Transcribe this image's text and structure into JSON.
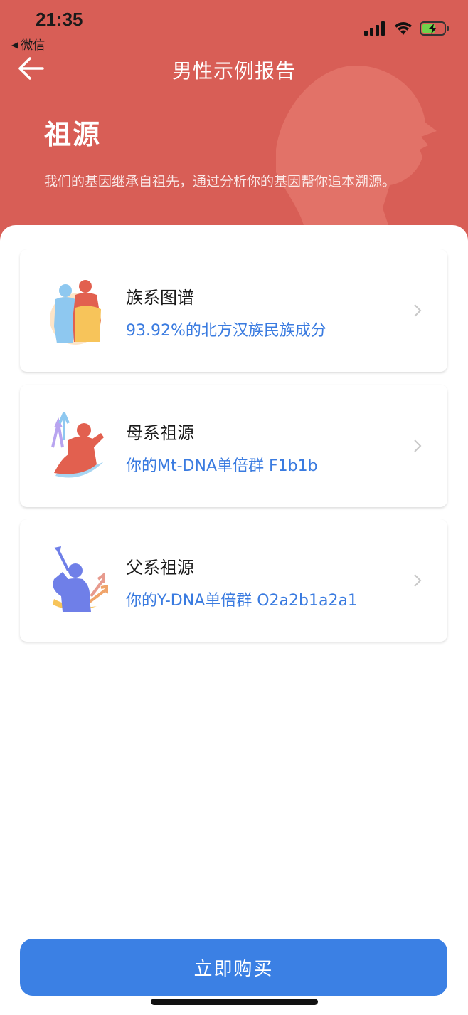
{
  "status_bar": {
    "time": "21:35",
    "back_app_label": "微信",
    "icons": [
      "signal-icon",
      "wifi-icon",
      "battery-charging-icon"
    ]
  },
  "nav": {
    "title": "男性示例报告",
    "back_icon": "arrow-left-icon"
  },
  "hero": {
    "title": "祖源",
    "subtitle": "我们的基因继承自祖先，通过分析你的基因帮你追本溯源。"
  },
  "cards": [
    {
      "title": "族系图谱",
      "subtitle": "93.92%的北方汉族民族成分",
      "icon": "ethnic-lineage-icon"
    },
    {
      "title": "母系祖源",
      "subtitle": "你的Mt-DNA单倍群   F1b1b",
      "icon": "maternal-ancestry-icon"
    },
    {
      "title": "父系祖源",
      "subtitle": "你的Y-DNA单倍群   O2a2b1a2a1",
      "icon": "paternal-ancestry-icon"
    }
  ],
  "buy_button": {
    "label": "立即购买"
  },
  "colors": {
    "header_bg": "#d85e56",
    "accent_blue": "#3b80e4",
    "link_blue": "#3a7be0"
  }
}
